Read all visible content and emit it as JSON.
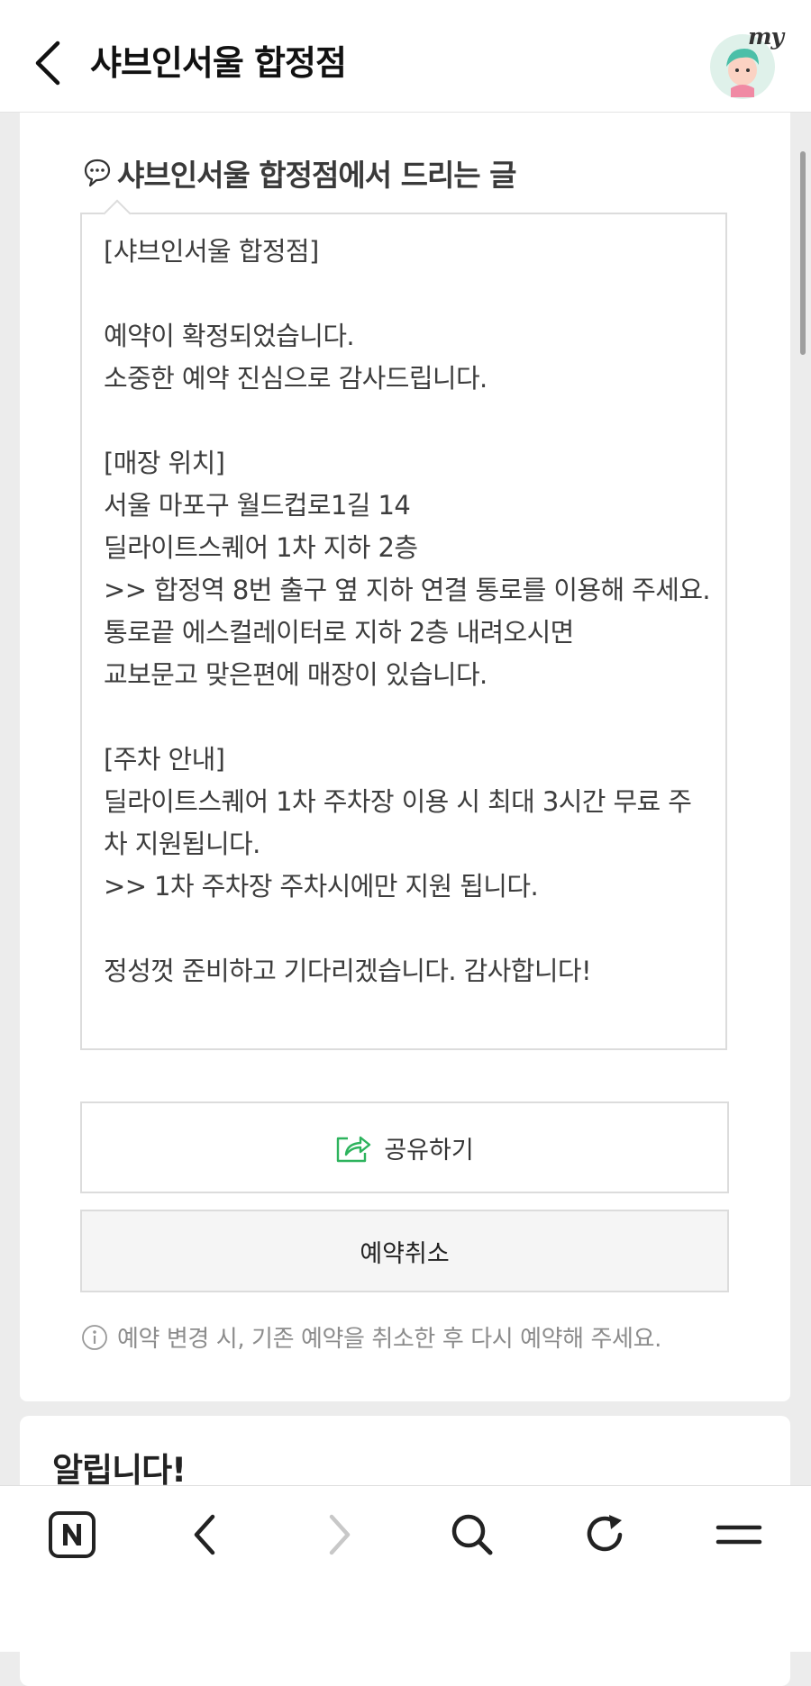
{
  "header": {
    "title": "샤브인서울 합정점",
    "avatar_badge": "my"
  },
  "message": {
    "title": "샤브인서울 합정점에서 드리는 글",
    "body": "[샤브인서울 합정점]\n\n예약이 확정되었습니다.\n소중한 예약 진심으로 감사드립니다.\n\n[매장 위치]\n서울 마포구 월드컵로1길 14\n딜라이트스퀘어 1차 지하 2층\n>> 합정역 8번 출구 옆 지하 연결 통로를 이용해 주세요.\n통로끝 에스컬레이터로 지하 2층 내려오시면\n교보문고 맞은편에 매장이 있습니다.\n\n[주차 안내]\n딜라이트스퀘어 1차 주차장 이용 시 최대 3시간 무료 주차 지원됩니다.\n>> 1차 주차장 주차시에만 지원 됩니다.\n\n정성껏 준비하고 기다리겠습니다. 감사합니다!"
  },
  "actions": {
    "share_label": "공유하기",
    "cancel_label": "예약취소"
  },
  "notice": {
    "text": "예약 변경 시, 기존 예약을 취소한 후 다시 예약해 주세요."
  },
  "announcement": {
    "title": "알립니다!"
  },
  "colors": {
    "accent_green": "#2db35d",
    "background": "#ececec"
  },
  "icons": {
    "back": "chevron-left-icon",
    "message": "speech-bubble-icon",
    "share": "share-icon",
    "info": "info-icon",
    "nav_home": "naver-n-icon",
    "nav_back": "chevron-left-icon",
    "nav_forward": "chevron-right-icon",
    "nav_search": "search-icon",
    "nav_refresh": "refresh-icon",
    "nav_menu": "menu-icon"
  }
}
